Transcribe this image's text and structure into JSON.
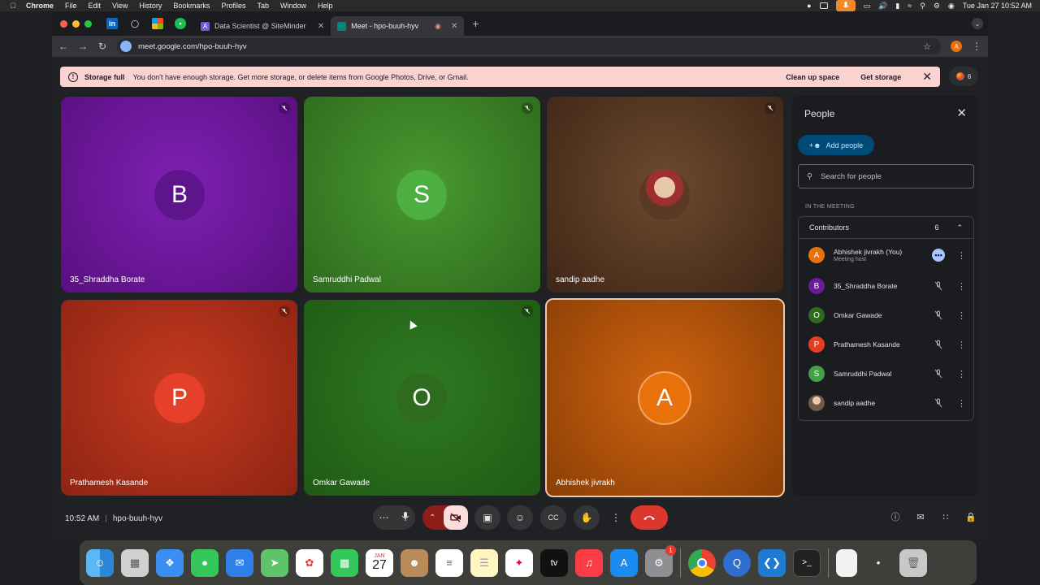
{
  "menubar": {
    "items": [
      "Chrome",
      "File",
      "Edit",
      "View",
      "History",
      "Bookmarks",
      "Profiles",
      "Tab",
      "Window",
      "Help"
    ],
    "datetime": "Tue Jan 27  10:52 AM"
  },
  "browser": {
    "tabs": [
      {
        "label": "Data Scientist @ SiteMinder",
        "active": false
      },
      {
        "label": "Meet - hpo-buuh-hyv",
        "active": true
      }
    ],
    "url": "meet.google.com/hpo-buuh-hyv",
    "profile_initial": "A"
  },
  "banner": {
    "title": "Storage full",
    "message": "You don't have enough storage. Get more storage, or delete items from Google Photos, Drive, or Gmail.",
    "action1": "Clean up space",
    "action2": "Get storage"
  },
  "participant_count": "6",
  "tiles": [
    {
      "name": "35_Shraddha Borate",
      "initial": "B",
      "bg": "#7b1fa2",
      "avatar": "#6a1b9a"
    },
    {
      "name": "Samruddhi Padwal",
      "initial": "S",
      "bg": "#3b8a2a",
      "avatar": "#43a047"
    },
    {
      "name": "sandip aadhe",
      "initial": "",
      "bg": "#5d3b24",
      "avatar": "#8a6a50"
    },
    {
      "name": "Prathamesh Kasande",
      "initial": "P",
      "bg": "#c0311c",
      "avatar": "#e53d20"
    },
    {
      "name": "Omkar Gawade",
      "initial": "O",
      "bg": "#2e6b1e",
      "avatar": "#2e6b1e"
    },
    {
      "name": "Abhishek jivrakh",
      "initial": "A",
      "bg": "#c85a0e",
      "avatar": "#e8710a"
    }
  ],
  "panel": {
    "title": "People",
    "add_label": "Add people",
    "search_placeholder": "Search for people",
    "section": "IN THE MEETING",
    "group_label": "Contributors",
    "group_count": "6",
    "people": [
      {
        "name": "Abhishek jivrakh (You)",
        "sub": "Meeting host",
        "initial": "A",
        "color": "#e8710a"
      },
      {
        "name": "35_Shraddha Borate",
        "sub": "",
        "initial": "B",
        "color": "#6a1b9a"
      },
      {
        "name": "Omkar Gawade",
        "sub": "",
        "initial": "O",
        "color": "#2e6b1e"
      },
      {
        "name": "Prathamesh Kasande",
        "sub": "",
        "initial": "P",
        "color": "#e53d20"
      },
      {
        "name": "Samruddhi Padwal",
        "sub": "",
        "initial": "S",
        "color": "#43a047"
      },
      {
        "name": "sandip aadhe",
        "sub": "",
        "initial": "",
        "color": "#6d5a48"
      }
    ]
  },
  "bottom": {
    "time": "10:52 AM",
    "meeting_code": "hpo-buuh-hyv"
  },
  "dock": {
    "calendar_month": "JAN",
    "calendar_day": "27",
    "settings_badge": "1"
  }
}
